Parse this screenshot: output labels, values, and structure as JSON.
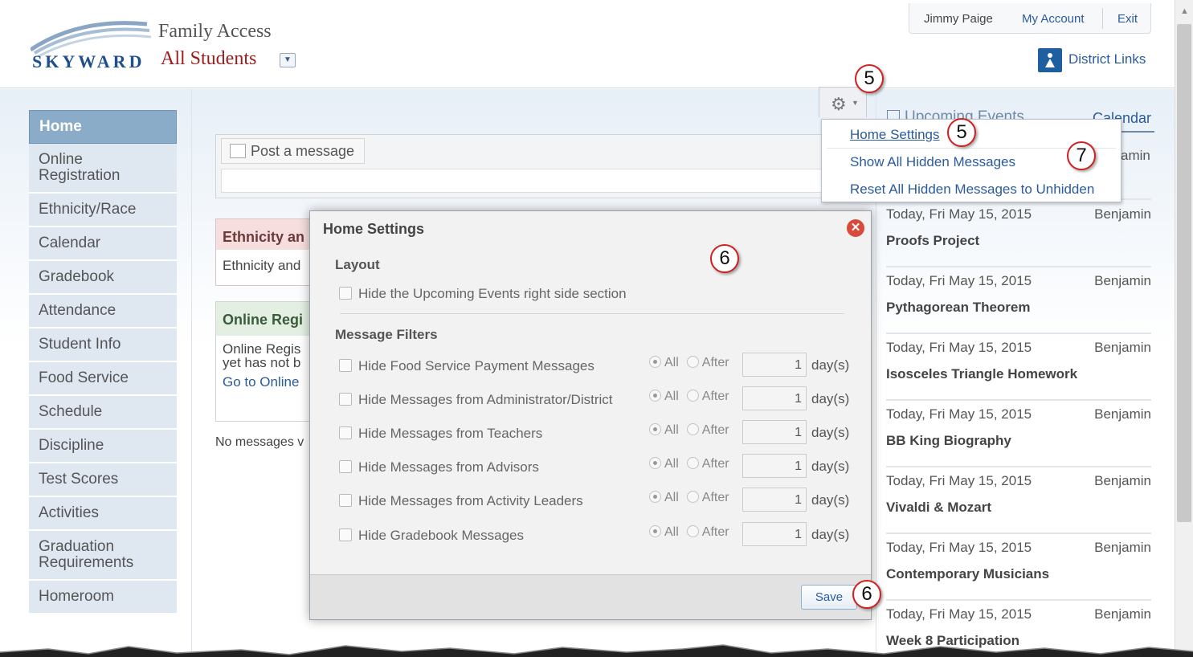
{
  "header": {
    "logo_text": "SKYWARD",
    "app_title": "Family Access",
    "student_selector": "All Students",
    "user_name": "Jimmy Paige",
    "my_account": "My Account",
    "exit": "Exit",
    "district_links": "District Links"
  },
  "sidebar": {
    "items": [
      {
        "label": "Home",
        "active": true
      },
      {
        "label": "Online Registration"
      },
      {
        "label": "Ethnicity/Race"
      },
      {
        "label": "Calendar"
      },
      {
        "label": "Gradebook"
      },
      {
        "label": "Attendance"
      },
      {
        "label": "Student Info"
      },
      {
        "label": "Food Service"
      },
      {
        "label": "Schedule"
      },
      {
        "label": "Discipline"
      },
      {
        "label": "Test Scores"
      },
      {
        "label": "Activities"
      },
      {
        "label": "Graduation Requirements"
      },
      {
        "label": "Homeroom"
      }
    ]
  },
  "main": {
    "post_message": "Post a message",
    "box1_head": "Ethnicity an",
    "box1_text": "Ethnicity and",
    "box2_head": "Online Regi",
    "box2_text1": "Online Regis",
    "box2_text2": "yet has not b",
    "box2_link": "Go to Online",
    "no_messages": "No messages v"
  },
  "gear_menu": {
    "home_settings": "Home Settings",
    "show_hidden": "Show All Hidden Messages",
    "reset_hidden": "Reset All Hidden Messages to Unhidden"
  },
  "callouts": {
    "c5a": "5",
    "c5b": "5",
    "c6a": "6",
    "c6b": "6",
    "c7": "7"
  },
  "events": {
    "title": "Upcoming Events",
    "calendar_link": "Calendar",
    "first_who_partial": "amin",
    "items": [
      {
        "date": "Today, Fri May 15, 2015",
        "who": "Benjamin",
        "title": "Proofs Project"
      },
      {
        "date": "Today, Fri May 15, 2015",
        "who": "Benjamin",
        "title": "Pythagorean Theorem"
      },
      {
        "date": "Today, Fri May 15, 2015",
        "who": "Benjamin",
        "title": "Isosceles Triangle Homework"
      },
      {
        "date": "Today, Fri May 15, 2015",
        "who": "Benjamin",
        "title": "BB King Biography"
      },
      {
        "date": "Today, Fri May 15, 2015",
        "who": "Benjamin",
        "title": "Vivaldi & Mozart"
      },
      {
        "date": "Today, Fri May 15, 2015",
        "who": "Benjamin",
        "title": "Contemporary Musicians"
      },
      {
        "date": "Today, Fri May 15, 2015",
        "who": "Benjamin",
        "title": "Week 8 Participation"
      }
    ]
  },
  "modal": {
    "title": "Home Settings",
    "layout_label": "Layout",
    "hide_events": "Hide the Upcoming Events right side section",
    "filters_label": "Message Filters",
    "all_label": "All",
    "after_label": "After",
    "days_label": "day(s)",
    "filters": [
      {
        "label": "Hide Food Service Payment Messages",
        "days": "1"
      },
      {
        "label": "Hide Messages from Administrator/District",
        "days": "1"
      },
      {
        "label": "Hide Messages from Teachers",
        "days": "1"
      },
      {
        "label": "Hide Messages from Advisors",
        "days": "1"
      },
      {
        "label": "Hide Messages from Activity Leaders",
        "days": "1"
      },
      {
        "label": "Hide Gradebook Messages",
        "days": "1"
      }
    ],
    "save": "Save"
  },
  "colors": {
    "accent": "#2a5b9d",
    "nav_active": "#8aacc9",
    "nav_bg": "#dfe8f1",
    "callout_border": "#d02020"
  }
}
